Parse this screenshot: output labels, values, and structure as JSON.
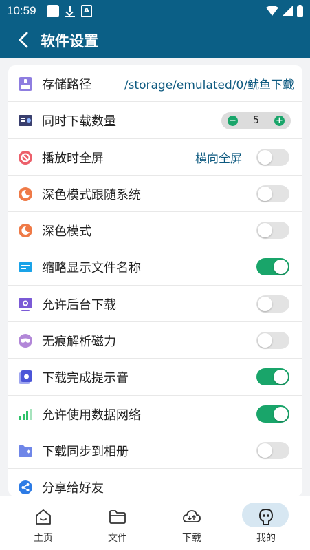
{
  "status_bar": {
    "time": "10:59"
  },
  "header": {
    "title": "软件设置"
  },
  "settings": [
    {
      "label": "存储路径",
      "value": "/storage/emulated/0/鱿鱼下载",
      "control": "value"
    },
    {
      "label": "同时下载数量",
      "control": "stepper",
      "stepper_value": "5",
      "minus": "−",
      "plus": "+"
    },
    {
      "label": "播放时全屏",
      "value": "横向全屏",
      "control": "toggle",
      "on": false
    },
    {
      "label": "深色模式跟随系统",
      "control": "toggle",
      "on": false
    },
    {
      "label": "深色模式",
      "control": "toggle",
      "on": false
    },
    {
      "label": "缩略显示文件名称",
      "control": "toggle",
      "on": true
    },
    {
      "label": "允许后台下载",
      "control": "toggle",
      "on": false
    },
    {
      "label": "无痕解析磁力",
      "control": "toggle",
      "on": false
    },
    {
      "label": "下载完成提示音",
      "control": "toggle",
      "on": true
    },
    {
      "label": "允许使用数据网络",
      "control": "toggle",
      "on": true
    },
    {
      "label": "下载同步到相册",
      "control": "toggle",
      "on": false
    },
    {
      "label": "分享给好友",
      "control": "none"
    }
  ],
  "nav": [
    {
      "label": "主页",
      "icon": "home-icon",
      "active": false
    },
    {
      "label": "文件",
      "icon": "folder-icon",
      "active": false
    },
    {
      "label": "下载",
      "icon": "cloud-download-icon",
      "active": false
    },
    {
      "label": "我的",
      "icon": "profile-icon",
      "active": true
    }
  ],
  "colors": {
    "primary": "#0b5f86",
    "toggle_on": "#19a56a",
    "toggle_off": "#e3e3e3",
    "nav_active_pill": "#d7e7f2",
    "value_text": "#0e5a80"
  }
}
